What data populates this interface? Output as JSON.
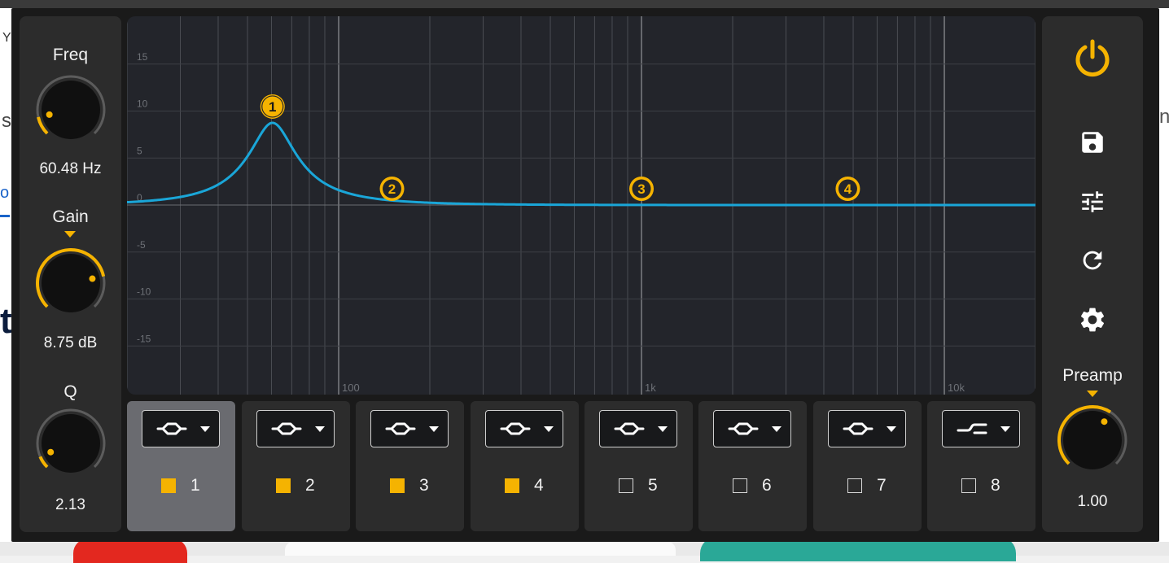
{
  "background": {
    "left_fragments": [
      "Y",
      "s",
      "o",
      "t"
    ],
    "right_fragments": [
      "ne"
    ]
  },
  "controls": {
    "freq": {
      "label": "Freq",
      "value": "60.48 Hz",
      "level": 0.12
    },
    "gain": {
      "label": "Gain",
      "value": "8.75 dB",
      "level": 0.79
    },
    "q": {
      "label": "Q",
      "value": "2.13",
      "level": 0.08
    },
    "preamp": {
      "label": "Preamp",
      "value": "1.00",
      "level": 0.62
    }
  },
  "toolbar": {
    "icons": [
      "power-icon",
      "save-icon",
      "tune-icon",
      "reset-icon",
      "settings-icon"
    ],
    "accent": "#f5b301"
  },
  "graph": {
    "y_ticks": [
      "15",
      "10",
      "5",
      "0",
      "-5",
      "-10",
      "-15"
    ],
    "x_ticks": [
      "100",
      "1k",
      "10k"
    ],
    "curve_color": "#1aa6d8",
    "markers": [
      {
        "label": "1",
        "active": true
      },
      {
        "label": "2",
        "active": false
      },
      {
        "label": "3",
        "active": false
      },
      {
        "label": "4",
        "active": false
      }
    ],
    "filter": {
      "freq_hz": 60.48,
      "gain_db": 8.75,
      "q": 2.13
    }
  },
  "bands": [
    {
      "num": "1",
      "enabled": true,
      "filter_icon": "peak-filter-icon",
      "selected": true
    },
    {
      "num": "2",
      "enabled": true,
      "filter_icon": "peak-filter-icon",
      "selected": false
    },
    {
      "num": "3",
      "enabled": true,
      "filter_icon": "peak-filter-icon",
      "selected": false
    },
    {
      "num": "4",
      "enabled": true,
      "filter_icon": "peak-filter-icon",
      "selected": false
    },
    {
      "num": "5",
      "enabled": false,
      "filter_icon": "peak-filter-icon",
      "selected": false
    },
    {
      "num": "6",
      "enabled": false,
      "filter_icon": "peak-filter-icon",
      "selected": false
    },
    {
      "num": "7",
      "enabled": false,
      "filter_icon": "peak-filter-icon",
      "selected": false
    },
    {
      "num": "8",
      "enabled": false,
      "filter_icon": "highshelf-filter-icon",
      "selected": false
    }
  ]
}
